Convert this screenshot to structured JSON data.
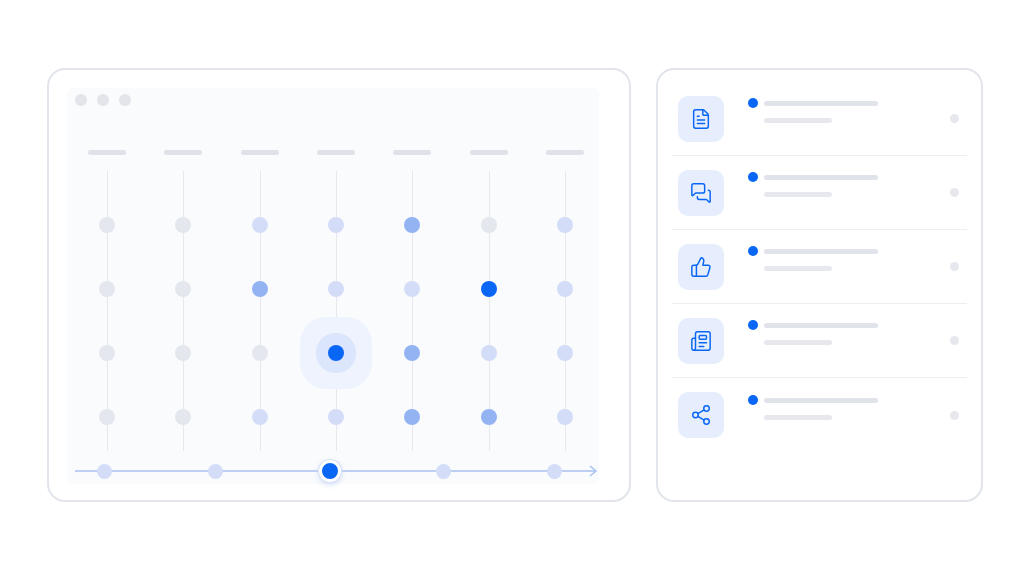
{
  "grid": {
    "columns": [
      {
        "kind": "heading"
      },
      {
        "kind": "heading"
      },
      {
        "kind": "heading"
      },
      {
        "kind": "heading"
      },
      {
        "kind": "heading"
      },
      {
        "kind": "heading"
      },
      {
        "kind": "heading"
      }
    ],
    "rows": [
      {
        "cells": [
          {
            "kind": "idle"
          },
          {
            "kind": "idle"
          },
          {
            "kind": "soft"
          },
          {
            "kind": "soft"
          },
          {
            "kind": "medium"
          },
          {
            "kind": "idle"
          },
          {
            "kind": "soft"
          }
        ]
      },
      {
        "cells": [
          {
            "kind": "idle"
          },
          {
            "kind": "idle"
          },
          {
            "kind": "medium"
          },
          {
            "kind": "soft"
          },
          {
            "kind": "soft"
          },
          {
            "kind": "active"
          },
          {
            "kind": "soft"
          }
        ]
      },
      {
        "cells": [
          {
            "kind": "idle"
          },
          {
            "kind": "idle"
          },
          {
            "kind": "idle"
          },
          {
            "kind": "focus"
          },
          {
            "kind": "medium"
          },
          {
            "kind": "soft"
          },
          {
            "kind": "soft"
          }
        ]
      },
      {
        "cells": [
          {
            "kind": "idle"
          },
          {
            "kind": "idle"
          },
          {
            "kind": "soft"
          },
          {
            "kind": "soft"
          },
          {
            "kind": "medium"
          },
          {
            "kind": "medium"
          },
          {
            "kind": "soft"
          }
        ]
      }
    ]
  },
  "timeline": {
    "points": [
      {
        "selected": false
      },
      {
        "selected": false
      },
      {
        "selected": true
      },
      {
        "selected": false
      },
      {
        "selected": false
      }
    ]
  },
  "feed": {
    "items": [
      {
        "unread": true
      },
      {
        "unread": true
      },
      {
        "unread": true
      },
      {
        "unread": true
      },
      {
        "unread": true
      }
    ]
  }
}
